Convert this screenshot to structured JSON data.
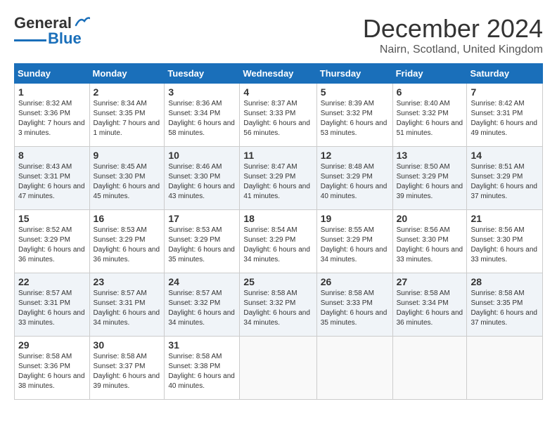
{
  "header": {
    "logo_general": "General",
    "logo_blue": "Blue",
    "month": "December 2024",
    "location": "Nairn, Scotland, United Kingdom"
  },
  "weekdays": [
    "Sunday",
    "Monday",
    "Tuesday",
    "Wednesday",
    "Thursday",
    "Friday",
    "Saturday"
  ],
  "weeks": [
    [
      {
        "day": "1",
        "sunrise": "8:32 AM",
        "sunset": "3:36 PM",
        "daylight": "7 hours and 3 minutes."
      },
      {
        "day": "2",
        "sunrise": "8:34 AM",
        "sunset": "3:35 PM",
        "daylight": "7 hours and 1 minute."
      },
      {
        "day": "3",
        "sunrise": "8:36 AM",
        "sunset": "3:34 PM",
        "daylight": "6 hours and 58 minutes."
      },
      {
        "day": "4",
        "sunrise": "8:37 AM",
        "sunset": "3:33 PM",
        "daylight": "6 hours and 56 minutes."
      },
      {
        "day": "5",
        "sunrise": "8:39 AM",
        "sunset": "3:32 PM",
        "daylight": "6 hours and 53 minutes."
      },
      {
        "day": "6",
        "sunrise": "8:40 AM",
        "sunset": "3:32 PM",
        "daylight": "6 hours and 51 minutes."
      },
      {
        "day": "7",
        "sunrise": "8:42 AM",
        "sunset": "3:31 PM",
        "daylight": "6 hours and 49 minutes."
      }
    ],
    [
      {
        "day": "8",
        "sunrise": "8:43 AM",
        "sunset": "3:31 PM",
        "daylight": "6 hours and 47 minutes."
      },
      {
        "day": "9",
        "sunrise": "8:45 AM",
        "sunset": "3:30 PM",
        "daylight": "6 hours and 45 minutes."
      },
      {
        "day": "10",
        "sunrise": "8:46 AM",
        "sunset": "3:30 PM",
        "daylight": "6 hours and 43 minutes."
      },
      {
        "day": "11",
        "sunrise": "8:47 AM",
        "sunset": "3:29 PM",
        "daylight": "6 hours and 41 minutes."
      },
      {
        "day": "12",
        "sunrise": "8:48 AM",
        "sunset": "3:29 PM",
        "daylight": "6 hours and 40 minutes."
      },
      {
        "day": "13",
        "sunrise": "8:50 AM",
        "sunset": "3:29 PM",
        "daylight": "6 hours and 39 minutes."
      },
      {
        "day": "14",
        "sunrise": "8:51 AM",
        "sunset": "3:29 PM",
        "daylight": "6 hours and 37 minutes."
      }
    ],
    [
      {
        "day": "15",
        "sunrise": "8:52 AM",
        "sunset": "3:29 PM",
        "daylight": "6 hours and 36 minutes."
      },
      {
        "day": "16",
        "sunrise": "8:53 AM",
        "sunset": "3:29 PM",
        "daylight": "6 hours and 36 minutes."
      },
      {
        "day": "17",
        "sunrise": "8:53 AM",
        "sunset": "3:29 PM",
        "daylight": "6 hours and 35 minutes."
      },
      {
        "day": "18",
        "sunrise": "8:54 AM",
        "sunset": "3:29 PM",
        "daylight": "6 hours and 34 minutes."
      },
      {
        "day": "19",
        "sunrise": "8:55 AM",
        "sunset": "3:29 PM",
        "daylight": "6 hours and 34 minutes."
      },
      {
        "day": "20",
        "sunrise": "8:56 AM",
        "sunset": "3:30 PM",
        "daylight": "6 hours and 33 minutes."
      },
      {
        "day": "21",
        "sunrise": "8:56 AM",
        "sunset": "3:30 PM",
        "daylight": "6 hours and 33 minutes."
      }
    ],
    [
      {
        "day": "22",
        "sunrise": "8:57 AM",
        "sunset": "3:31 PM",
        "daylight": "6 hours and 33 minutes."
      },
      {
        "day": "23",
        "sunrise": "8:57 AM",
        "sunset": "3:31 PM",
        "daylight": "6 hours and 34 minutes."
      },
      {
        "day": "24",
        "sunrise": "8:57 AM",
        "sunset": "3:32 PM",
        "daylight": "6 hours and 34 minutes."
      },
      {
        "day": "25",
        "sunrise": "8:58 AM",
        "sunset": "3:32 PM",
        "daylight": "6 hours and 34 minutes."
      },
      {
        "day": "26",
        "sunrise": "8:58 AM",
        "sunset": "3:33 PM",
        "daylight": "6 hours and 35 minutes."
      },
      {
        "day": "27",
        "sunrise": "8:58 AM",
        "sunset": "3:34 PM",
        "daylight": "6 hours and 36 minutes."
      },
      {
        "day": "28",
        "sunrise": "8:58 AM",
        "sunset": "3:35 PM",
        "daylight": "6 hours and 37 minutes."
      }
    ],
    [
      {
        "day": "29",
        "sunrise": "8:58 AM",
        "sunset": "3:36 PM",
        "daylight": "6 hours and 38 minutes."
      },
      {
        "day": "30",
        "sunrise": "8:58 AM",
        "sunset": "3:37 PM",
        "daylight": "6 hours and 39 minutes."
      },
      {
        "day": "31",
        "sunrise": "8:58 AM",
        "sunset": "3:38 PM",
        "daylight": "6 hours and 40 minutes."
      },
      null,
      null,
      null,
      null
    ]
  ]
}
